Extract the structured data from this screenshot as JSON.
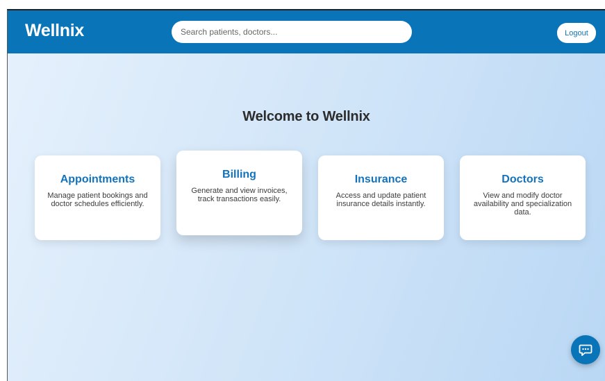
{
  "header": {
    "brand": "Wellnix",
    "search_placeholder": "Search patients, doctors...",
    "logout_label": "Logout"
  },
  "main": {
    "welcome_title": "Welcome to Wellnix",
    "cards": [
      {
        "title": "Appointments",
        "description": "Manage patient bookings and doctor schedules efficiently."
      },
      {
        "title": "Billing",
        "description": "Generate and view invoices, track transactions easily."
      },
      {
        "title": "Insurance",
        "description": "Access and update patient insurance details instantly."
      },
      {
        "title": "Doctors",
        "description": "View and modify doctor availability and specialization data."
      }
    ]
  },
  "chat": {
    "icon": "chat-bubble-icon"
  },
  "colors": {
    "header_bg": "#0a74b8",
    "card_title": "#1272bb",
    "background_start": "#e6f1fc",
    "background_end": "#b9d7f4"
  }
}
